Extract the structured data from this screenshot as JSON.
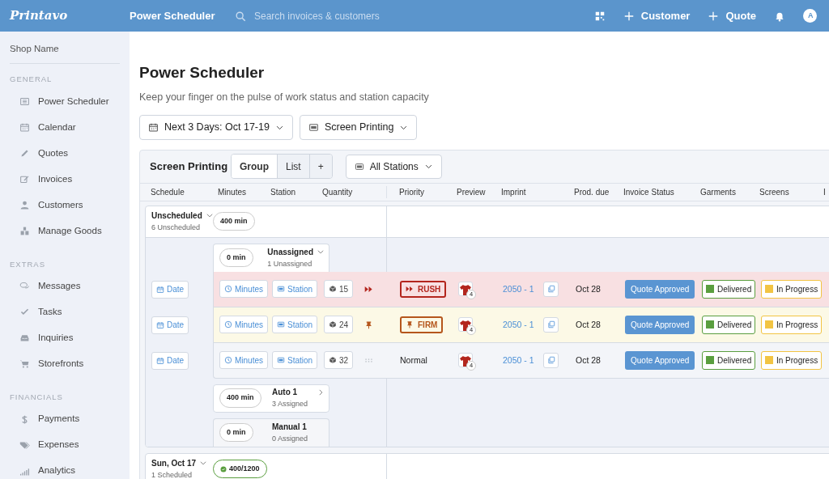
{
  "topbar": {
    "logo": "Printavo",
    "page_title": "Power Scheduler",
    "search": {
      "placeholder": "Search invoices & customers"
    },
    "actions": [
      {
        "kind": "grid"
      },
      {
        "kind": "add",
        "label": "Customer"
      },
      {
        "kind": "add",
        "label": "Quote"
      },
      {
        "kind": "bell"
      },
      {
        "kind": "avatar",
        "label": "A"
      }
    ]
  },
  "sidebar": {
    "shop_name": "Shop Name",
    "sections": [
      {
        "heading": "GENERAL",
        "items": [
          {
            "kind": "list",
            "label": "Power Scheduler"
          },
          {
            "kind": "calendar",
            "label": "Calendar"
          },
          {
            "kind": "pencil",
            "label": "Quotes"
          },
          {
            "kind": "edit",
            "label": "Invoices"
          },
          {
            "kind": "person",
            "label": "Customers"
          },
          {
            "kind": "boxes",
            "label": "Manage Goods"
          }
        ]
      },
      {
        "heading": "EXTRAS",
        "items": [
          {
            "kind": "chat",
            "label": "Messages"
          },
          {
            "kind": "check",
            "label": "Tasks"
          },
          {
            "kind": "inbox",
            "label": "Inquiries"
          },
          {
            "kind": "cart",
            "label": "Storefronts"
          }
        ]
      },
      {
        "heading": "FINANCIALS",
        "items": [
          {
            "kind": "dollar",
            "label": "Payments"
          },
          {
            "kind": "tag",
            "label": "Expenses"
          },
          {
            "kind": "bars",
            "label": "Analytics"
          }
        ]
      }
    ]
  },
  "page": {
    "title": "Power Scheduler",
    "subtitle": "Keep your finger on the pulse of work status and station capacity",
    "filters": [
      {
        "kind": "calendar",
        "label": "Next 3 Days: Oct 17-19"
      },
      {
        "kind": "station",
        "label": "Screen Printing"
      }
    ]
  },
  "board": {
    "title": "Screen Printing",
    "views": [
      {
        "label": "Group",
        "selected": true
      },
      {
        "label": "List",
        "selected": false
      },
      {
        "label": "+",
        "selected": false
      }
    ],
    "station_filter": "All Stations",
    "columns": [
      "Schedule",
      "Minutes",
      "Station",
      "Quantity",
      "Priority",
      "Preview",
      "Imprint",
      "Prod. due",
      "Invoice Status",
      "Garments",
      "Screens",
      "I"
    ],
    "groups": [
      {
        "title": "Unscheduled",
        "subtitle": "6 Unscheduled",
        "minutes": "400 min",
        "complete": false,
        "expanded": true,
        "stations": [
          {
            "title": "Unassigned",
            "subtitle": "1 Unassigned",
            "minutes": "0 min",
            "expanded": true,
            "jobs": [
              {
                "kind": "rush",
                "priority_label": "RUSH",
                "date": "Date",
                "minutes": "Minutes",
                "station": "Station",
                "quantity": "15",
                "preview_count": "4",
                "imprint": "2050 - 1",
                "due": "Oct 28",
                "invoice_status": "Quote Approved",
                "garments": {
                  "label": "Delivered",
                  "color": "#5a9e3f"
                },
                "screens": {
                  "label": "In Progress",
                  "color": "#f2c443"
                }
              },
              {
                "kind": "firm",
                "priority_label": "FIRM",
                "date": "Date",
                "minutes": "Minutes",
                "station": "Station",
                "quantity": "24",
                "preview_count": "4",
                "imprint": "2050 - 1",
                "due": "Oct 28",
                "invoice_status": "Quote Approved",
                "garments": {
                  "label": "Delivered",
                  "color": "#5a9e3f"
                },
                "screens": {
                  "label": "In Progress",
                  "color": "#f2c443"
                }
              },
              {
                "kind": "normal",
                "priority_label": "Normal",
                "date": "Date",
                "minutes": "Minutes",
                "station": "Station",
                "quantity": "32",
                "preview_count": "4",
                "imprint": "2050 - 1",
                "due": "Oct 28",
                "invoice_status": "Quote Approved",
                "garments": {
                  "label": "Delivered",
                  "color": "#5a9e3f"
                },
                "screens": {
                  "label": "In Progress",
                  "color": "#f2c443"
                }
              }
            ]
          },
          {
            "title": "Auto 1",
            "subtitle": "3 Assigned",
            "minutes": "400 min",
            "expanded": false
          },
          {
            "title": "Manual 1",
            "subtitle": "0 Assigned",
            "minutes": "0 min"
          }
        ]
      },
      {
        "title": "Sun, Oct 17",
        "subtitle": "1 Scheduled",
        "minutes": "400/1200",
        "complete": true,
        "expanded": true
      }
    ]
  }
}
